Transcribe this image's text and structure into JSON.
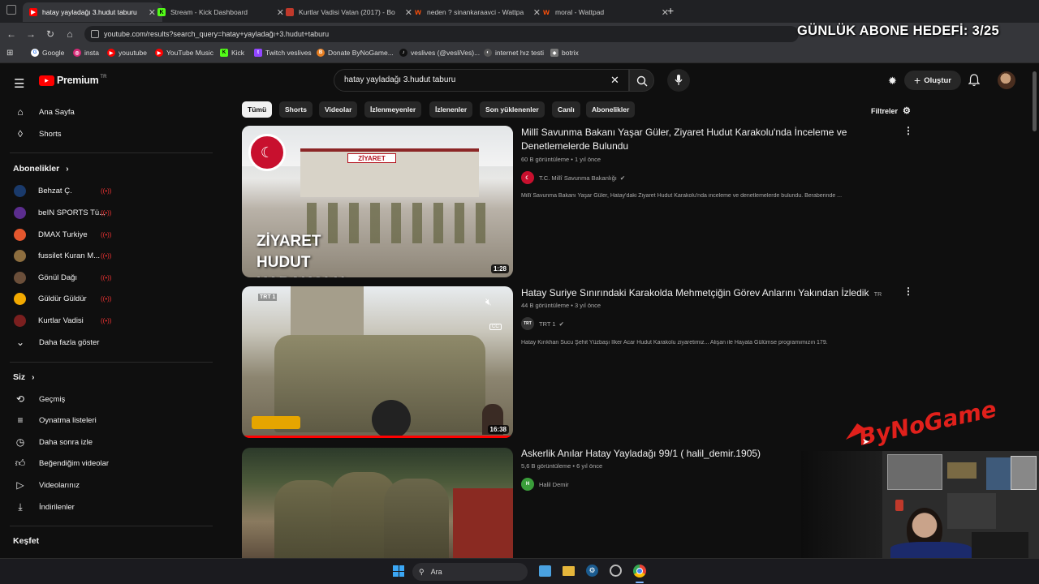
{
  "browser": {
    "tabs": [
      {
        "title": "hatay yayladağı 3.hudut taburu",
        "favicon_color": "#ff0000",
        "favicon_glyph": "▶"
      },
      {
        "title": "Stream - Kick Dashboard",
        "favicon_color": "#53fc18",
        "favicon_glyph": "K"
      },
      {
        "title": "Kurtlar Vadisi Vatan (2017) - Bo",
        "favicon_color": "#c0392b",
        "favicon_glyph": ""
      },
      {
        "title": "neden ? sinankaraavci - Wattpa",
        "favicon_color": "#ff500a",
        "favicon_glyph": "w"
      },
      {
        "title": "moral - Wattpad",
        "favicon_color": "#ff500a",
        "favicon_glyph": "w"
      }
    ],
    "new_tab": "+",
    "url": "youtube.com/results?search_query=hatay+yayladağı+3.hudut+taburu",
    "bookmarks": [
      {
        "label": "Google",
        "color": "#4285f4",
        "glyph": "G"
      },
      {
        "label": "insta",
        "color": "#d62976",
        "glyph": "◎"
      },
      {
        "label": "youutube",
        "color": "#ff0000",
        "glyph": "▶"
      },
      {
        "label": "YouTube Music",
        "color": "#ff0000",
        "glyph": "▶"
      },
      {
        "label": "Kick",
        "color": "#53fc18",
        "glyph": "K"
      },
      {
        "label": "Twitch veslives",
        "color": "#9146ff",
        "glyph": "t"
      },
      {
        "label": "Donate ByNoGame...",
        "color": "#e67e22",
        "glyph": "B"
      },
      {
        "label": "veslives (@vesliVes)...",
        "color": "#111111",
        "glyph": "♪"
      },
      {
        "label": "internet hız testi",
        "color": "#555555",
        "glyph": "◐"
      },
      {
        "label": "botrix",
        "color": "#777777",
        "glyph": "◆"
      }
    ]
  },
  "overlay": {
    "goal_text": "GÜNLÜK ABONE HEDEFİ: 3/25",
    "watermark": "ByNoGame"
  },
  "youtube": {
    "logo_text": "Premium",
    "logo_region": "TR",
    "search_value": "hatay yayladağı 3.hudut taburu",
    "create_label": "Oluştur",
    "sidebar": {
      "main": [
        {
          "label": "Ana Sayfa",
          "icon": "home-icon"
        },
        {
          "label": "Shorts",
          "icon": "shorts-icon"
        }
      ],
      "subs_title": "Abonelikler",
      "subs": [
        {
          "label": "Behzat Ç.",
          "color": "#1a3a6b",
          "live": true
        },
        {
          "label": "beIN SPORTS Tü...",
          "color": "#5b2d8e",
          "live": true
        },
        {
          "label": "DMAX Turkiye",
          "color": "#e4572e",
          "live": true
        },
        {
          "label": "fussilet Kuran M...",
          "color": "#8d6e3f",
          "live": true
        },
        {
          "label": "Gönül Dağı",
          "color": "#6b4f3a",
          "live": true
        },
        {
          "label": "Güldür Güldür",
          "color": "#f2a900",
          "live": true
        },
        {
          "label": "Kurtlar Vadisi",
          "color": "#7a1f1f",
          "live": true
        }
      ],
      "more_label": "Daha fazla göster",
      "you_title": "Siz",
      "you": [
        {
          "label": "Geçmiş",
          "icon": "history-icon"
        },
        {
          "label": "Oynatma listeleri",
          "icon": "playlists-icon"
        },
        {
          "label": "Daha sonra izle",
          "icon": "watch-later-icon"
        },
        {
          "label": "Beğendiğim videolar",
          "icon": "like-icon"
        },
        {
          "label": "Videolarınız",
          "icon": "your-videos-icon"
        },
        {
          "label": "İndirilenler",
          "icon": "download-icon"
        }
      ],
      "explore_title": "Keşfet"
    },
    "chips": [
      "Tümü",
      "Shorts",
      "Videolar",
      "İzlenmeyenler",
      "İzlenenler",
      "Son yüklenenler",
      "Canlı",
      "Abonelikler"
    ],
    "filters_label": "Filtreler",
    "results": [
      {
        "title": "Millî Savunma Bakanı Yaşar Güler, Ziyaret Hudut Karakolu'nda İnceleme ve Denetlemelerde Bulundu",
        "meta": "60 B görüntüleme • 1 yıl önce",
        "channel": "T.C. Millî Savunma Bakanlığı",
        "channel_color": "#c8102e",
        "verified": true,
        "description": "Millî Savunma Bakanı Yaşar Güler, Hatay'daki Ziyaret Hudut Karakolu'nda inceleme ve denetlemelerde bulundu. Beraberinde ...",
        "duration": "1:28",
        "thumb_text": "ZİYARET HUDUT KARAKOLU",
        "thumb_sign": "ZİYARET"
      },
      {
        "title": "Hatay Suriye Sınırındaki Karakolda Mehmetçiğin Görev Anlarını Yakından İzledik",
        "title_badge": "TR",
        "meta": "44 B görüntüleme • 3 yıl önce",
        "channel": "TRT 1",
        "channel_color": "#333333",
        "verified": true,
        "description": "Hatay Kırıkhan Sucu Şehit Yüzbaşı İlker Acar Hudut Karakolu ziyaretimiz... Alişan ile Hayata Gülümse programımızın 179.",
        "duration": "16:38",
        "thumb_logo": "TRT 1",
        "thumb_cc": "CC"
      },
      {
        "title": "Askerlik Anılar Hatay Yayladağı 99/1 ( halil_demir.1905)",
        "meta": "5,6 B görüntüleme • 6 yıl önce",
        "channel": "Halil Demir",
        "channel_color": "#3a9d3a",
        "channel_initial": "H",
        "verified": false
      }
    ]
  },
  "taskbar": {
    "search_label": "Ara"
  }
}
